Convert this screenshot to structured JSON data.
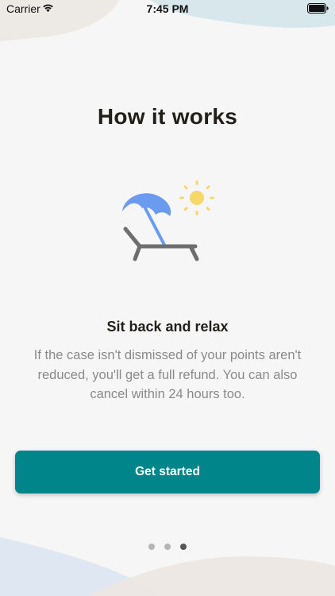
{
  "status_bar": {
    "carrier": "Carrier",
    "time": "7:45 PM",
    "wifi_icon": "wifi-icon",
    "battery_icon": "battery-icon"
  },
  "onboarding": {
    "title": "How it works",
    "illustration": "beach-chair-umbrella-sun-icon",
    "step_heading": "Sit back and relax",
    "step_body": "If the case isn't dismissed of your points aren't reduced, you'll get a full refund. You can also cancel within 24 hours too.",
    "cta_label": "Get started",
    "pager": {
      "total": 3,
      "current": 3
    }
  },
  "colors": {
    "background": "#f6f6f6",
    "accent": "#00858a",
    "umbrella": "#6b9bef",
    "sun": "#f7d66a",
    "chair": "#6e6e6e",
    "dot_active": "#555555",
    "dot_inactive": "#b5b5b5"
  }
}
